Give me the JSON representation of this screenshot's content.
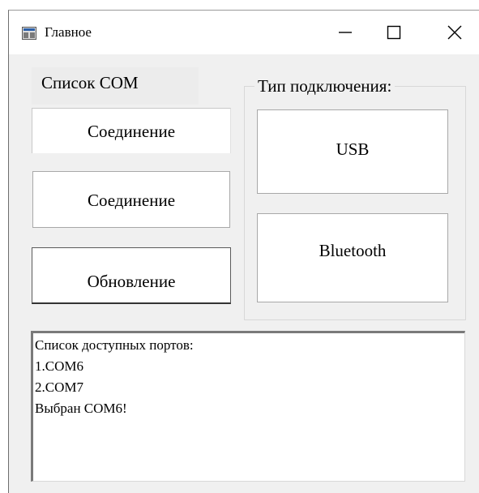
{
  "window": {
    "title": "Главное",
    "controls": {
      "minimize": "—",
      "close": "✕"
    }
  },
  "left_panel": {
    "com_list_label": "Список COM",
    "connect_button_1": "Соединение",
    "connect_button_2": "Соединение",
    "update_button": "Обновление"
  },
  "connection_type": {
    "legend": "Тип подключения:",
    "usb_button": "USB",
    "bluetooth_button": "Bluetooth"
  },
  "log": {
    "lines": [
      "Список доступных портов:",
      "1.COM6",
      "2.COM7",
      "Выбран COM6!"
    ]
  }
}
